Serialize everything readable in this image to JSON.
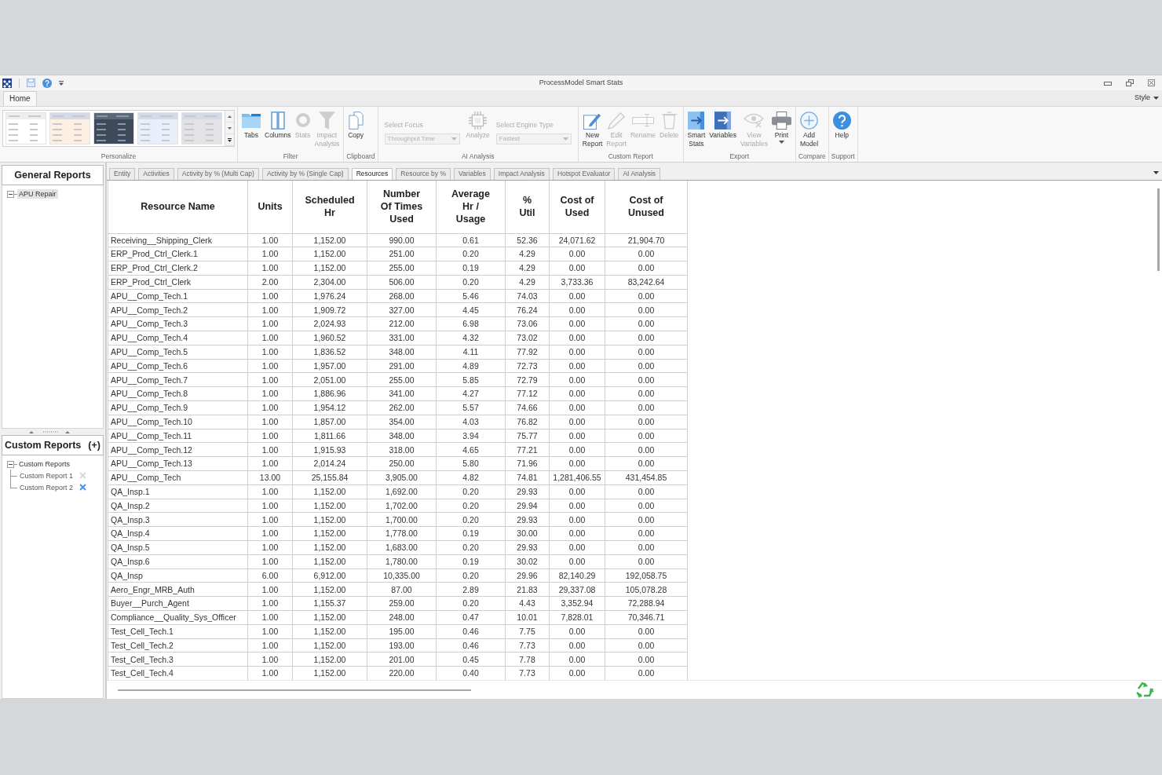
{
  "window": {
    "title": "ProcessModel Smart Stats"
  },
  "ribbon_tabs": [
    {
      "label": "Home",
      "selected": true
    }
  ],
  "style_menu": {
    "label": "Style"
  },
  "ribbon_groups": [
    {
      "label": "Personalize",
      "kind": "gallery",
      "thumbnails": [
        {
          "color": "#ffffff"
        },
        {
          "color": "#fdf0e2"
        },
        {
          "color": "#3e4a59"
        },
        {
          "color": "#e8eefa"
        },
        {
          "color": "#e3e3e7"
        }
      ]
    },
    {
      "label": "Filter",
      "kind": "buttons",
      "items": [
        {
          "kind": "button",
          "label": "Tabs",
          "disabled": false
        },
        {
          "kind": "button",
          "label": "Columns",
          "disabled": false
        },
        {
          "kind": "button",
          "label": "Stats",
          "disabled": true
        },
        {
          "kind": "button",
          "label": "Impact Analysis",
          "disabled": true
        }
      ]
    },
    {
      "label": "Clipboard",
      "kind": "buttons",
      "items": [
        {
          "kind": "button",
          "label": "Copy",
          "disabled": false
        }
      ]
    },
    {
      "label": "AI Analysis",
      "kind": "buttons",
      "items": [
        {
          "kind": "combo",
          "label": "Select Focus",
          "value": "Throughput Time",
          "disabled": true
        },
        {
          "kind": "button",
          "label": "Analyze",
          "disabled": true
        },
        {
          "kind": "combo",
          "label": "Select Engine Type",
          "value": "Fastest",
          "disabled": true
        }
      ]
    },
    {
      "label": "Custom Report",
      "kind": "buttons",
      "items": [
        {
          "kind": "button",
          "label": "New Report",
          "disabled": false
        },
        {
          "kind": "button",
          "label": "Edit Report",
          "disabled": true
        },
        {
          "kind": "button",
          "label": "Rename",
          "disabled": true
        },
        {
          "kind": "button",
          "label": "Delete",
          "disabled": true
        }
      ]
    },
    {
      "label": "Export",
      "kind": "buttons",
      "items": [
        {
          "kind": "button",
          "label": "Smart Stats",
          "disabled": false
        },
        {
          "kind": "button",
          "label": "Variables",
          "disabled": false
        },
        {
          "kind": "button",
          "label": "View Variables",
          "disabled": true
        },
        {
          "kind": "menu_button",
          "label": "Print",
          "disabled": false
        }
      ]
    },
    {
      "label": "Compare",
      "kind": "buttons",
      "items": [
        {
          "kind": "button",
          "label": "Add Model",
          "disabled": false
        }
      ]
    },
    {
      "label": "Support",
      "kind": "buttons",
      "items": [
        {
          "kind": "button",
          "label": "Help",
          "disabled": false
        }
      ]
    }
  ],
  "general_reports": {
    "title": "General Reports",
    "tree": [
      {
        "label": "APU Repair",
        "expanded": true,
        "selected": true
      }
    ]
  },
  "custom_reports": {
    "title": "Custom Reports",
    "add_label": "(+)",
    "tree": [
      {
        "label": "Custom Reports",
        "expanded": true,
        "children": [
          {
            "label": "Custom Report 1",
            "hovered": false
          },
          {
            "label": "Custom Report 2",
            "hovered": true
          }
        ]
      }
    ]
  },
  "report_tabs": [
    {
      "label": "Entity",
      "selected": false
    },
    {
      "label": "Activities",
      "selected": false
    },
    {
      "label": "Activity by % (Multi Cap)",
      "selected": false
    },
    {
      "label": "Activity by % (Single Cap)",
      "selected": false
    },
    {
      "label": "Resources",
      "selected": true
    },
    {
      "label": "Resource by %",
      "selected": false
    },
    {
      "label": "Variables",
      "selected": false
    },
    {
      "label": "Impact Analysis",
      "selected": false
    },
    {
      "label": "Hotspot Evaluator",
      "selected": false
    },
    {
      "label": "AI Analysis",
      "selected": false
    }
  ],
  "table": {
    "columns": [
      "Resource Name",
      "Units",
      "Scheduled\nHr",
      "Number\nOf Times\nUsed",
      "Average\nHr /\nUsage",
      "%\nUtil",
      "Cost of\nUsed",
      "Cost of\nUnused"
    ],
    "rows": [
      [
        "Receiving__Shipping_Clerk",
        "1.00",
        "1,152.00",
        "990.00",
        "0.61",
        "52.36",
        "24,071.62",
        "21,904.70"
      ],
      [
        "ERP_Prod_Ctrl_Clerk.1",
        "1.00",
        "1,152.00",
        "251.00",
        "0.20",
        "4.29",
        "0.00",
        "0.00"
      ],
      [
        "ERP_Prod_Ctrl_Clerk.2",
        "1.00",
        "1,152.00",
        "255.00",
        "0.19",
        "4.29",
        "0.00",
        "0.00"
      ],
      [
        "ERP_Prod_Ctrl_Clerk",
        "2.00",
        "2,304.00",
        "506.00",
        "0.20",
        "4.29",
        "3,733.36",
        "83,242.64"
      ],
      [
        "APU__Comp_Tech.1",
        "1.00",
        "1,976.24",
        "268.00",
        "5.46",
        "74.03",
        "0.00",
        "0.00"
      ],
      [
        "APU__Comp_Tech.2",
        "1.00",
        "1,909.72",
        "327.00",
        "4.45",
        "76.24",
        "0.00",
        "0.00"
      ],
      [
        "APU__Comp_Tech.3",
        "1.00",
        "2,024.93",
        "212.00",
        "6.98",
        "73.06",
        "0.00",
        "0.00"
      ],
      [
        "APU__Comp_Tech.4",
        "1.00",
        "1,960.52",
        "331.00",
        "4.32",
        "73.02",
        "0.00",
        "0.00"
      ],
      [
        "APU__Comp_Tech.5",
        "1.00",
        "1,836.52",
        "348.00",
        "4.11",
        "77.92",
        "0.00",
        "0.00"
      ],
      [
        "APU__Comp_Tech.6",
        "1.00",
        "1,957.00",
        "291.00",
        "4.89",
        "72.73",
        "0.00",
        "0.00"
      ],
      [
        "APU__Comp_Tech.7",
        "1.00",
        "2,051.00",
        "255.00",
        "5.85",
        "72.79",
        "0.00",
        "0.00"
      ],
      [
        "APU__Comp_Tech.8",
        "1.00",
        "1,886.96",
        "341.00",
        "4.27",
        "77.12",
        "0.00",
        "0.00"
      ],
      [
        "APU__Comp_Tech.9",
        "1.00",
        "1,954.12",
        "262.00",
        "5.57",
        "74.66",
        "0.00",
        "0.00"
      ],
      [
        "APU__Comp_Tech.10",
        "1.00",
        "1,857.00",
        "354.00",
        "4.03",
        "76.82",
        "0.00",
        "0.00"
      ],
      [
        "APU__Comp_Tech.11",
        "1.00",
        "1,811.66",
        "348.00",
        "3.94",
        "75.77",
        "0.00",
        "0.00"
      ],
      [
        "APU__Comp_Tech.12",
        "1.00",
        "1,915.93",
        "318.00",
        "4.65",
        "77.21",
        "0.00",
        "0.00"
      ],
      [
        "APU__Comp_Tech.13",
        "1.00",
        "2,014.24",
        "250.00",
        "5.80",
        "71.96",
        "0.00",
        "0.00"
      ],
      [
        "APU__Comp_Tech",
        "13.00",
        "25,155.84",
        "3,905.00",
        "4.82",
        "74.81",
        "1,281,406.55",
        "431,454.85"
      ],
      [
        "QA_Insp.1",
        "1.00",
        "1,152.00",
        "1,692.00",
        "0.20",
        "29.93",
        "0.00",
        "0.00"
      ],
      [
        "QA_Insp.2",
        "1.00",
        "1,152.00",
        "1,702.00",
        "0.20",
        "29.94",
        "0.00",
        "0.00"
      ],
      [
        "QA_Insp.3",
        "1.00",
        "1,152.00",
        "1,700.00",
        "0.20",
        "29.93",
        "0.00",
        "0.00"
      ],
      [
        "QA_Insp.4",
        "1.00",
        "1,152.00",
        "1,778.00",
        "0.19",
        "30.00",
        "0.00",
        "0.00"
      ],
      [
        "QA_Insp.5",
        "1.00",
        "1,152.00",
        "1,683.00",
        "0.20",
        "29.93",
        "0.00",
        "0.00"
      ],
      [
        "QA_Insp.6",
        "1.00",
        "1,152.00",
        "1,780.00",
        "0.19",
        "30.02",
        "0.00",
        "0.00"
      ],
      [
        "QA_Insp",
        "6.00",
        "6,912.00",
        "10,335.00",
        "0.20",
        "29.96",
        "82,140.29",
        "192,058.75"
      ],
      [
        "Aero_Engr_MRB_Auth",
        "1.00",
        "1,152.00",
        "87.00",
        "2.89",
        "21.83",
        "29,337.08",
        "105,078.28"
      ],
      [
        "Buyer__Purch_Agent",
        "1.00",
        "1,155.37",
        "259.00",
        "0.20",
        "4.43",
        "3,352.94",
        "72,288.94"
      ],
      [
        "Compliance__Quality_Sys_Officer",
        "1.00",
        "1,152.00",
        "248.00",
        "0.47",
        "10.01",
        "7,828.01",
        "70,346.71"
      ],
      [
        "Test_Cell_Tech.1",
        "1.00",
        "1,152.00",
        "195.00",
        "0.46",
        "7.75",
        "0.00",
        "0.00"
      ],
      [
        "Test_Cell_Tech.2",
        "1.00",
        "1,152.00",
        "193.00",
        "0.46",
        "7.73",
        "0.00",
        "0.00"
      ],
      [
        "Test_Cell_Tech.3",
        "1.00",
        "1,152.00",
        "201.00",
        "0.45",
        "7.78",
        "0.00",
        "0.00"
      ],
      [
        "Test_Cell_Tech.4",
        "1.00",
        "1,152.00",
        "220.00",
        "0.40",
        "7.73",
        "0.00",
        "0.00"
      ]
    ]
  }
}
